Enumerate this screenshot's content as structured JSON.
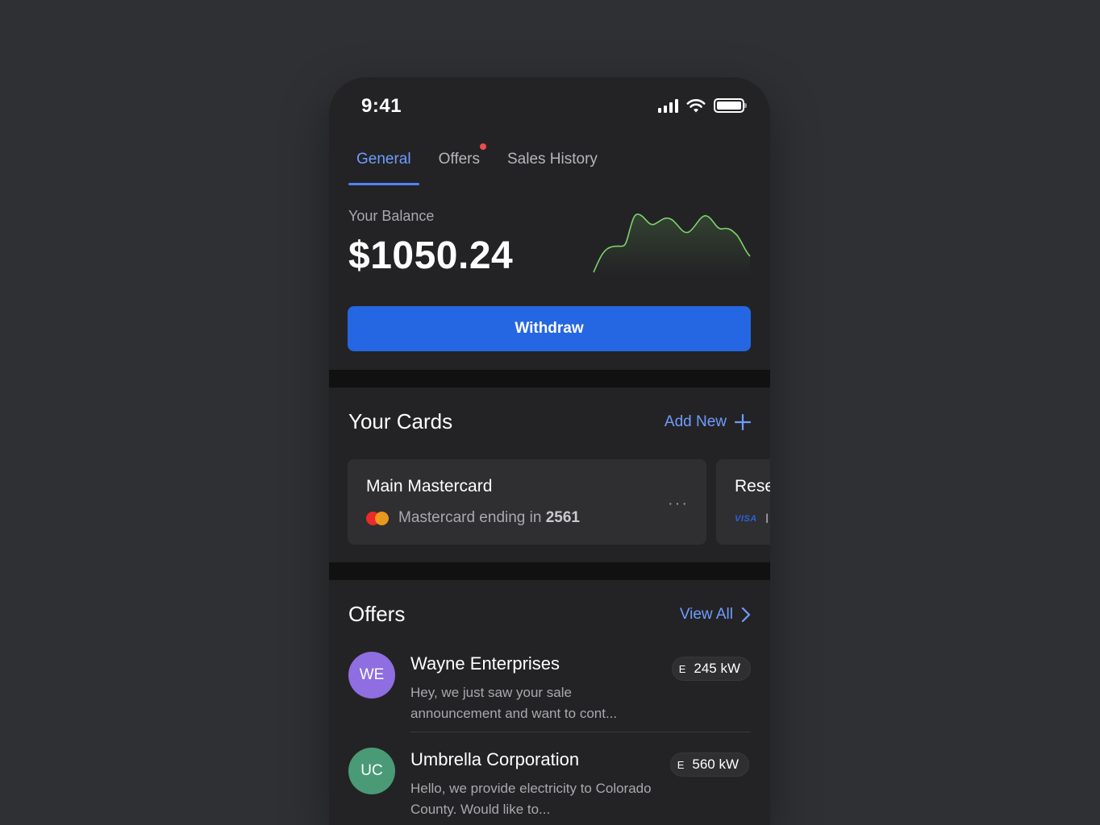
{
  "status": {
    "time": "9:41"
  },
  "tabs": [
    {
      "label": "General",
      "active": true,
      "notification": false
    },
    {
      "label": "Offers",
      "active": false,
      "notification": true
    },
    {
      "label": "Sales History",
      "active": false,
      "notification": false
    }
  ],
  "balance": {
    "label": "Your Balance",
    "value": "$1050.24",
    "trend_color": "#7fd26b"
  },
  "withdraw": {
    "label": "Withdraw"
  },
  "cards_section": {
    "title": "Your Cards",
    "action_label": "Add New",
    "cards": [
      {
        "title": "Main Mastercard",
        "subtitle_prefix": "Mastercard ending in",
        "last4": "2561",
        "brand_icon": "mastercard-icon"
      },
      {
        "title": "Rese",
        "subtitle_prefix": "I",
        "brand_icon": "visa-icon",
        "brand_text": "VISA"
      }
    ]
  },
  "offers_section": {
    "title": "Offers",
    "action_label": "View All",
    "items": [
      {
        "initials": "WE",
        "avatar_color": "#8e6ee0",
        "name": "Wayne Enterprises",
        "message": "Hey, we just saw your sale announcement and want to cont...",
        "badge_prefix": "E",
        "badge_value": "245 kW"
      },
      {
        "initials": "UC",
        "avatar_color": "#4a9a78",
        "name": "Umbrella Corporation",
        "message": "Hello, we provide electricity to Colorado County. Would like to...",
        "badge_prefix": "E",
        "badge_value": "560 kW"
      }
    ]
  },
  "colors": {
    "accent": "#2566e3",
    "link": "#6f9cff",
    "notification": "#ef4b4b"
  }
}
